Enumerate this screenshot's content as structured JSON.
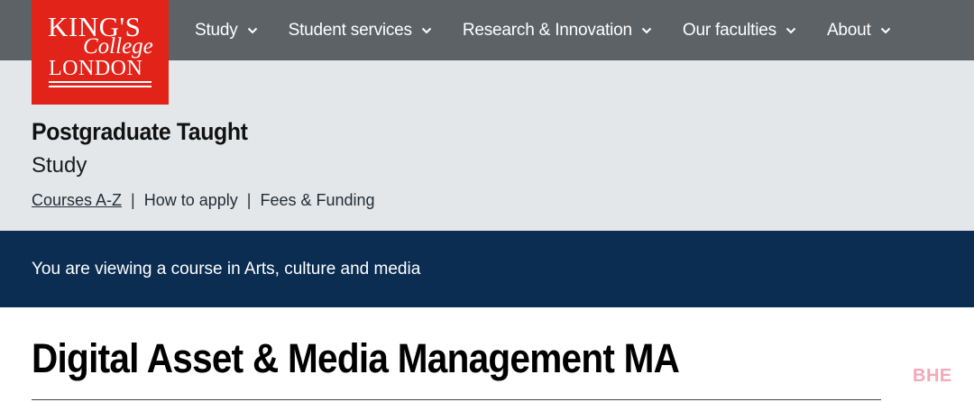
{
  "logo": {
    "line1": "KING'S",
    "line2": "College",
    "line3": "LONDON"
  },
  "nav": {
    "items": [
      {
        "label": "Study"
      },
      {
        "label": "Student services"
      },
      {
        "label": "Research & Innovation"
      },
      {
        "label": "Our faculties"
      },
      {
        "label": "About"
      }
    ]
  },
  "section": {
    "title": "Postgraduate Taught",
    "subtitle": "Study",
    "links": [
      {
        "label": "Courses A-Z"
      },
      {
        "label": "How to apply"
      },
      {
        "label": "Fees & Funding"
      }
    ],
    "separator": "|"
  },
  "banner": {
    "text": "You are viewing a course in Arts, culture and media"
  },
  "course": {
    "title": "Digital Asset & Media Management MA"
  },
  "watermark": "BHE",
  "colors": {
    "nav_bg": "#5d6266",
    "logo_red": "#e2231a",
    "subhead_bg": "#e4e7e9",
    "banner_navy": "#0b2d52"
  }
}
